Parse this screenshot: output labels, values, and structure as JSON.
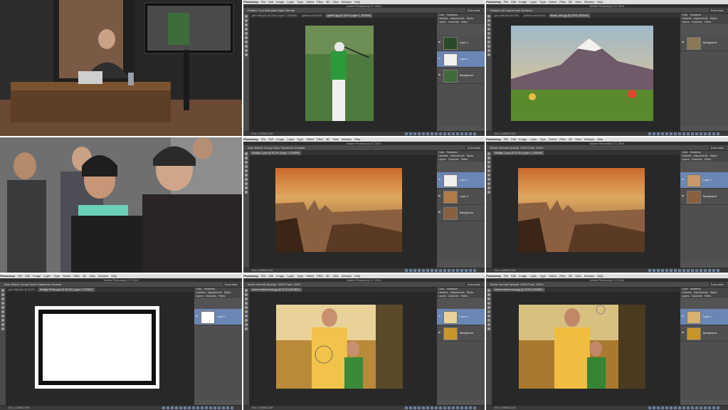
{
  "mac_menu": [
    "Photoshop",
    "File",
    "Edit",
    "Image",
    "Layer",
    "Type",
    "Select",
    "Filter",
    "3D",
    "View",
    "Window",
    "Help"
  ],
  "window_title": "Adobe Photoshop CC 2014",
  "panels": {
    "tabs_top": [
      "Color",
      "Swatches"
    ],
    "tabs_mid": [
      "Libraries",
      "Adjustments",
      "Styles"
    ],
    "tabs_layers": [
      "Layers",
      "Channels",
      "Paths"
    ]
  },
  "tiles": {
    "t2": {
      "options": "Feather: 0 px   Anti-alias   Style: Normal",
      "workspace": "Essentials",
      "tabs": [
        "girl~child.psd @ 33% (Layer 1, RGB/8*)",
        "golfer.psd @ 50%",
        "golfer3.jpg @ 100% (Layer 1, RGB/8*)"
      ],
      "status": "Doc: 1.02M/1.02M",
      "layers": [
        "Layer 1",
        "Layer 0",
        "Background"
      ]
    },
    "t3": {
      "options": "Sample: All Layers   Auto-Enhance",
      "workspace": "Essentials",
      "tabs": [
        "girl~child.psd @ 33%",
        "golfer3.psd @ 50%",
        "flower_mtn.jpg @ 100% (RGB/8*)"
      ],
      "status": "Doc: 3.00M/3.00M",
      "layers": [
        "Background"
      ]
    },
    "t5": {
      "options": "Auto-Select: Group   Show Transform Controls",
      "workspace": "Essentials",
      "tabs": [
        "Multiply 1.psd @ 33.3% (Layer 1, RGB/8*)"
      ],
      "status": "Doc: 1.65M/3.31M",
      "layers": [
        "Layer 1",
        "Layer 0",
        "Background"
      ]
    },
    "t6": {
      "options": "Mode: Normal   Opacity: 100%   Flow: 100%",
      "workspace": "Essentials",
      "tabs": [
        "Multiply 1.psd @ 33.3% (Layer 1, RGB/8*)"
      ],
      "status": "Doc: 1.65M/3.31M",
      "layers": [
        "Layer 1",
        "Background"
      ]
    },
    "t7": {
      "options": "Auto-Select: Group   Show Transform Controls",
      "workspace": "Essentials",
      "tabs": [
        "girl~child.psd @ 66.7%",
        "Multiply Photo.psd @ 33.3% (Layer 1, RGB/8*)"
      ],
      "status": "Doc: 1.24M/2.04M",
      "layers": [
        "Layer 1"
      ]
    },
    "t8": {
      "options": "Mode: Normal   Opacity: 100%   Flow: 100%",
      "workspace": "Essentials",
      "tabs": [
        "screen blend mode.jpg @ 33.3% (RGB/8*)"
      ],
      "status": "Doc: 3.06M/6.13M",
      "layers": [
        "Layer 1",
        "Background"
      ]
    },
    "t9": {
      "options": "Mode: Normal   Opacity: 100%   Flow: 100%",
      "workspace": "Essentials",
      "tabs": [
        "screen blend mode.jpg @ 33.3% (RGB/8*)"
      ],
      "status": "Doc: 3.06M/6.13M",
      "layers": [
        "Layer 1",
        "Background"
      ]
    }
  }
}
